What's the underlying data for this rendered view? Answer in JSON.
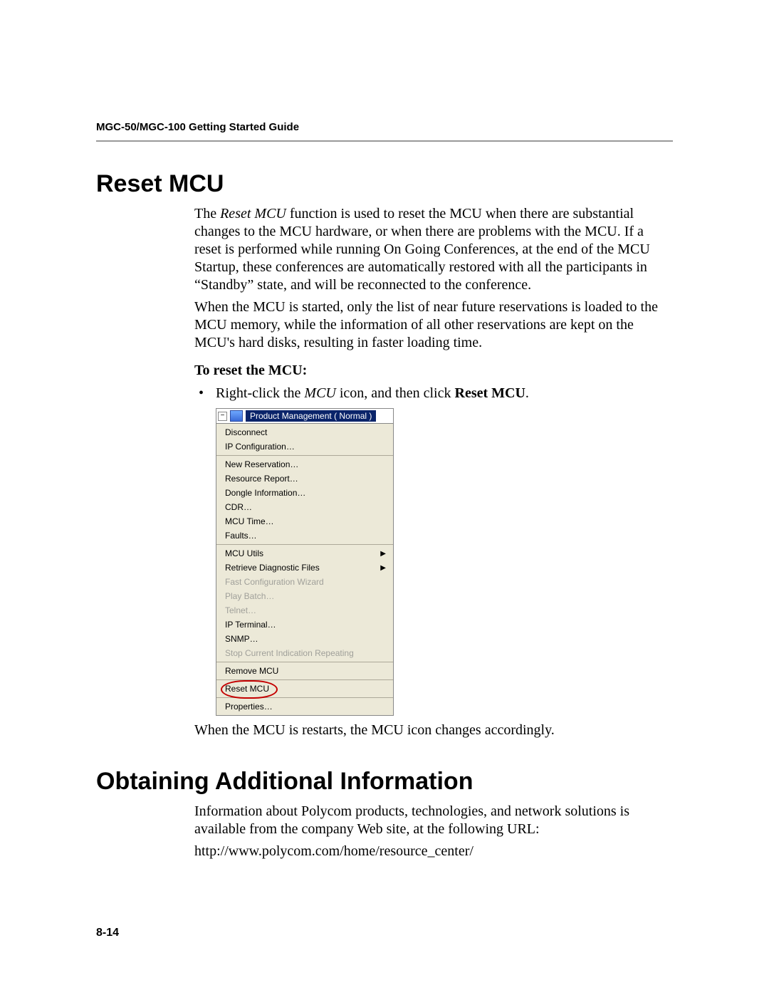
{
  "header": "MGC-50/MGC-100 Getting Started Guide",
  "section1": {
    "title": "Reset MCU",
    "p1_pre": "The ",
    "p1_em": "Reset MCU",
    "p1_post": " function is used to reset the MCU when there are substantial changes to the MCU hardware, or when there are problems with the MCU. If a reset is performed while running On Going Conferences, at the end of the MCU Startup, these conferences are automatically restored with all the participants in “Standby” state, and will be reconnected to the conference.",
    "p2": "When the MCU is started, only the list of near future reservations is loaded to the MCU memory, while the information of all other reservations are kept on the MCU's hard disks, resulting in faster loading time.",
    "subhead": "To reset the MCU:",
    "bullet_pre": "Right-click the ",
    "bullet_em": "MCU",
    "bullet_mid": " icon, and then click ",
    "bullet_strong": "Reset MCU",
    "bullet_post": ".",
    "after_menu": "When the MCU is restarts, the MCU icon changes accordingly."
  },
  "menu": {
    "tree_label": "Product Management   ( Normal )",
    "groups": [
      [
        {
          "label": "Disconnect",
          "disabled": false
        },
        {
          "label": "IP Configuration…",
          "disabled": false
        }
      ],
      [
        {
          "label": "New Reservation…",
          "disabled": false
        },
        {
          "label": "Resource Report…",
          "disabled": false
        },
        {
          "label": "Dongle Information…",
          "disabled": false
        },
        {
          "label": "CDR…",
          "disabled": false
        },
        {
          "label": "MCU Time…",
          "disabled": false
        },
        {
          "label": "Faults…",
          "disabled": false
        }
      ],
      [
        {
          "label": "MCU Utils",
          "disabled": false,
          "submenu": true
        },
        {
          "label": "Retrieve Diagnostic Files",
          "disabled": false,
          "submenu": true
        },
        {
          "label": "Fast Configuration Wizard",
          "disabled": true
        },
        {
          "label": "Play Batch…",
          "disabled": true
        },
        {
          "label": "Telnet…",
          "disabled": true
        },
        {
          "label": "IP Terminal…",
          "disabled": false
        },
        {
          "label": "SNMP…",
          "disabled": false
        },
        {
          "label": "Stop Current Indication Repeating",
          "disabled": true
        }
      ],
      [
        {
          "label": "Remove MCU",
          "disabled": false
        }
      ],
      [
        {
          "label": "Reset MCU",
          "disabled": false,
          "highlight": true
        }
      ],
      [
        {
          "label": "Properties…",
          "disabled": false
        }
      ]
    ]
  },
  "section2": {
    "title": "Obtaining Additional Information",
    "p1": "Information about Polycom products, technologies, and network solutions is available from the company Web site, at the following URL:",
    "url": "http://www.polycom.com/home/resource_center/"
  },
  "page_number": "8-14"
}
